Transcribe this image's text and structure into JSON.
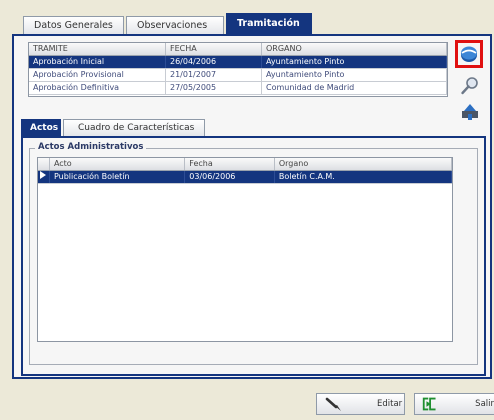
{
  "top_tabs": [
    "Datos Generales",
    "Observaciones",
    "Tramitación"
  ],
  "tramite_table": {
    "headers": [
      "TRAMITE",
      "FECHA",
      "ORGANO"
    ],
    "rows": [
      [
        "Aprobación Inicial",
        "26/04/2006",
        "Ayuntamiento Pinto"
      ],
      [
        "Aprobación Provisional",
        "21/01/2007",
        "Ayuntamiento Pinto"
      ],
      [
        "Aprobación Definitiva",
        "27/05/2005",
        "Comunidad de Madrid"
      ]
    ],
    "selected_row": 0
  },
  "side_buttons": {
    "first_icon": "save-disk-icon",
    "second_icon": "magnifier-icon",
    "third_icon": "pin-icon"
  },
  "sub_tabs": [
    "Actos",
    "Cuadro de Características"
  ],
  "actos_group": {
    "title": "Actos Administrativos",
    "headers": [
      "Acto",
      "Fecha",
      "Organo"
    ],
    "rows": [
      [
        "Publicación Boletín",
        "03/06/2006",
        "Boletín C.A.M."
      ]
    ],
    "selected_row": 0
  },
  "bottom_buttons": {
    "editar_label": "Editar",
    "salir_label": "Salir"
  },
  "colors": {
    "accent": "#14357f",
    "highlight": "#e01010"
  }
}
